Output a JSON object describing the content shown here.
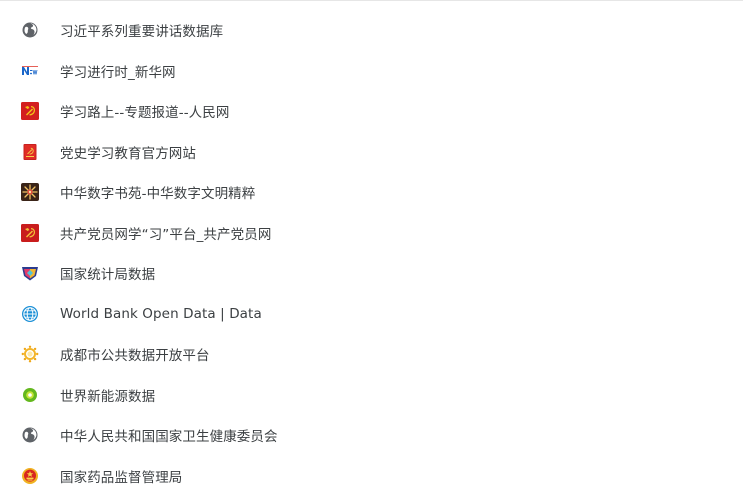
{
  "bookmarks": {
    "items": [
      {
        "label": "习近平系列重要讲话数据库",
        "icon": "globe-icon"
      },
      {
        "label": "学习进行时_新华网",
        "icon": "xinhua-news-icon"
      },
      {
        "label": "学习路上--专题报道--人民网",
        "icon": "party-emblem-icon"
      },
      {
        "label": "党史学习教育官方网站",
        "icon": "party-history-book-icon"
      },
      {
        "label": "中华数字书苑-中华数字文明精粹",
        "icon": "starburst-icon"
      },
      {
        "label": "共产党员网学“习”平台_共产党员网",
        "icon": "party-emblem-icon"
      },
      {
        "label": "国家统计局数据",
        "icon": "stats-shield-icon"
      },
      {
        "label": "World Bank Open Data | Data",
        "icon": "world-bank-globe-icon"
      },
      {
        "label": "成都市公共数据开放平台",
        "icon": "sun-ring-icon"
      },
      {
        "label": "世界新能源数据",
        "icon": "green-circle-icon"
      },
      {
        "label": "中华人民共和国国家卫生健康委员会",
        "icon": "globe-icon"
      },
      {
        "label": "国家药品监督管理局",
        "icon": "national-emblem-icon"
      }
    ]
  }
}
